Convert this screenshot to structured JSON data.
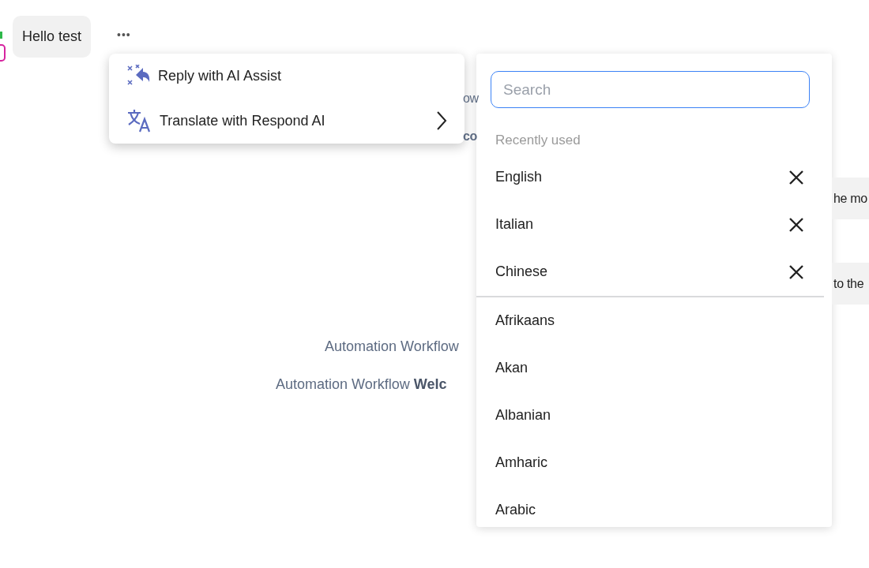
{
  "message": {
    "text": "Hello test",
    "more_button": "•••"
  },
  "background_fragments": [
    {
      "text": "ow",
      "kind": "plain"
    },
    {
      "text": "co",
      "kind": "bold"
    }
  ],
  "right_bubbles": [
    "he mo",
    "to the"
  ],
  "system_lines": [
    "Automation Workflow",
    "Automation Workflow **Welc**"
  ],
  "context_menu": {
    "items": [
      {
        "label": "Reply with AI Assist",
        "kind": "reply",
        "submenu": false
      },
      {
        "label": "Translate with Respond AI",
        "kind": "translate",
        "submenu": true
      }
    ]
  },
  "language_picker": {
    "search": {
      "placeholder": "Search"
    },
    "recent_heading": "Recently used",
    "recent": [
      "English",
      "Italian",
      "Chinese"
    ],
    "languages": [
      "Afrikaans",
      "Akan",
      "Albanian",
      "Amharic",
      "Arabic"
    ]
  }
}
